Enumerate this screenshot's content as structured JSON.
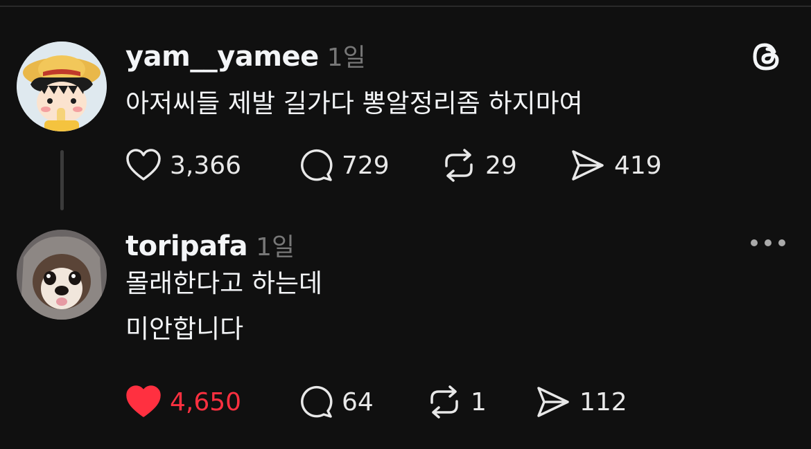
{
  "posts": [
    {
      "username": "yam__yamee",
      "timestamp": "1일",
      "lines": [
        "아저씨들 제발 길가다 뽕알정리좀 하지마여"
      ],
      "likes": "3,366",
      "comments": "729",
      "reposts": "29",
      "shares": "419",
      "liked": false,
      "avatar_icon": "cartoon-girl-avatar"
    },
    {
      "username": "toripafa",
      "timestamp": "1일",
      "lines": [
        "몰래한다고 하는데",
        "미안합니다"
      ],
      "likes": "4,650",
      "comments": "64",
      "reposts": "1",
      "shares": "112",
      "liked": true,
      "avatar_icon": "dog-avatar"
    }
  ],
  "icons": {
    "like": "heart-icon",
    "comment": "comment-bubble-icon",
    "repost": "repost-icon",
    "share": "send-icon",
    "brand": "threads-logo-icon",
    "more": "more-dots-icon"
  },
  "colors": {
    "background": "#101010",
    "text": "#f3f5f7",
    "muted": "#777777",
    "liked": "#ff3040"
  }
}
